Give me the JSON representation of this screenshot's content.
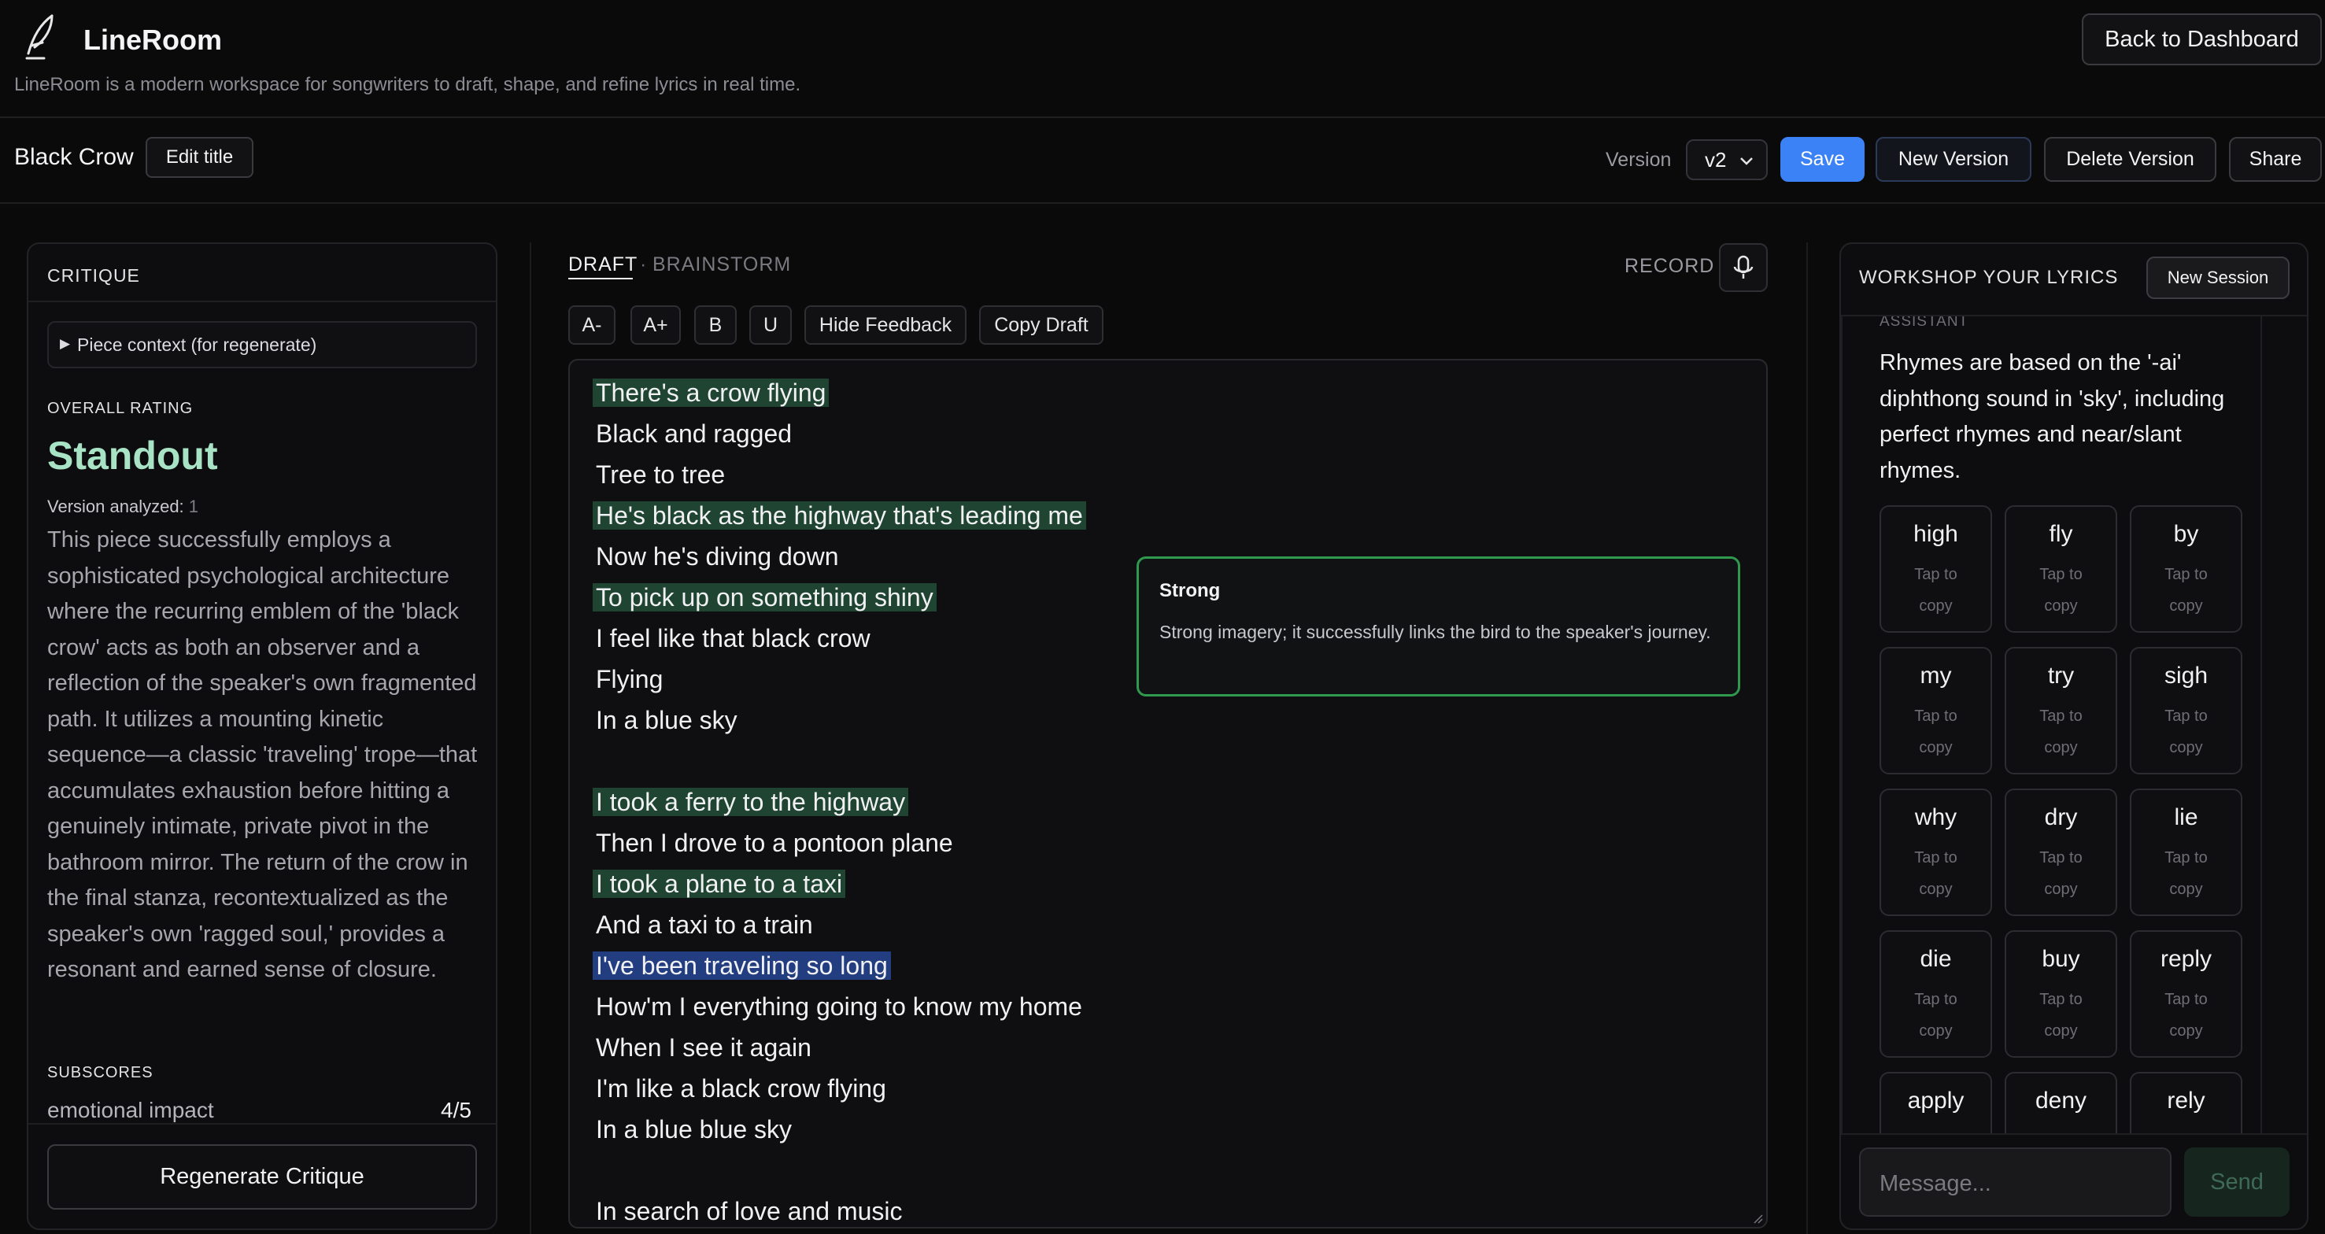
{
  "app": {
    "name": "LineRoom",
    "description": "LineRoom is a modern workspace for songwriters to draft, shape, and refine lyrics in real time.",
    "back_button": "Back to Dashboard"
  },
  "document": {
    "title": "Black Crow",
    "edit_title_button": "Edit title",
    "version_label": "Version",
    "version_selected": "v2",
    "save_button": "Save",
    "new_version_button": "New Version",
    "delete_version_button": "Delete Version",
    "share_button": "Share"
  },
  "critique": {
    "heading": "CRITIQUE",
    "piece_context": "Piece context (for regenerate)",
    "overall_rating_label": "OVERALL RATING",
    "rating": "Standout",
    "version_analyzed_label": "Version analyzed:",
    "version_analyzed_value": "1",
    "text": "This piece successfully employs a sophisticated psychological architecture where the recurring emblem of the 'black crow' acts as both an observer and a reflection of the speaker's own fragmented path. It utilizes a mounting kinetic sequence—a classic 'traveling' trope—that accumulates exhaustion before hitting a genuinely intimate, private pivot in the bathroom mirror. The return of the crow in the final stanza, recontextualized as the speaker's own 'ragged soul,' provides a resonant and earned sense of closure.",
    "subscores_label": "SUBSCORES",
    "subscores": [
      {
        "name": "emotional impact",
        "score": "4/5"
      }
    ],
    "regenerate_button": "Regenerate Critique"
  },
  "draft": {
    "tab_draft": "DRAFT",
    "tab_separator": "·",
    "tab_brainstorm": "BRAINSTORM",
    "record_label": "RECORD",
    "toolbar": {
      "font_smaller": "A-",
      "font_larger": "A+",
      "bold": "B",
      "underline": "U",
      "hide_feedback": "Hide Feedback",
      "copy_draft": "Copy Draft"
    },
    "lines": [
      {
        "text": "There's a crow flying",
        "hl": "green"
      },
      {
        "text": "Black and ragged",
        "hl": ""
      },
      {
        "text": "Tree to tree",
        "hl": ""
      },
      {
        "text": "He's black as the highway that's leading me",
        "hl": "green"
      },
      {
        "text": "Now he's diving down",
        "hl": ""
      },
      {
        "text": "To pick up on something shiny",
        "hl": "green"
      },
      {
        "text": "I feel like that black crow",
        "hl": ""
      },
      {
        "text": "Flying",
        "hl": ""
      },
      {
        "text": "In a blue sky",
        "hl": ""
      },
      {
        "text": "",
        "hl": ""
      },
      {
        "text": "I took a ferry to the highway",
        "hl": "green"
      },
      {
        "text": "Then I drove to a pontoon plane",
        "hl": ""
      },
      {
        "text": "I took a plane to a taxi",
        "hl": "green"
      },
      {
        "text": "And a taxi to a train",
        "hl": ""
      },
      {
        "text": "I've been traveling so long",
        "hl": "blue"
      },
      {
        "text": "How'm I everything going to know my home",
        "hl": ""
      },
      {
        "text": "When I see it again",
        "hl": ""
      },
      {
        "text": "I'm like a black crow flying",
        "hl": ""
      },
      {
        "text": "In a blue blue sky",
        "hl": ""
      },
      {
        "text": "",
        "hl": ""
      },
      {
        "text": "In search of love and music",
        "hl": ""
      }
    ],
    "feedback": {
      "title": "Strong",
      "text": "Strong imagery; it successfully links the bird to the speaker's journey."
    }
  },
  "workshop": {
    "heading": "WORKSHOP YOUR LYRICS",
    "new_session_button": "New Session",
    "role_label": "ASSISTANT",
    "message": "Rhymes are based on the '-ai' diphthong sound in 'sky', including perfect rhymes and near/slant rhymes.",
    "rhyme_hint_line1": "Tap to",
    "rhyme_hint_line2": "copy",
    "rhymes": [
      "high",
      "fly",
      "by",
      "my",
      "try",
      "sigh",
      "why",
      "dry",
      "lie",
      "die",
      "buy",
      "reply",
      "apply",
      "deny",
      "rely"
    ],
    "message_placeholder": "Message...",
    "send_button": "Send"
  },
  "colors": {
    "accent_blue": "#3b82f6",
    "rating_green": "#a7e3c4",
    "highlight_green": "#1f4532",
    "highlight_blue": "#233e80",
    "feedback_border": "#2f9a4e"
  }
}
